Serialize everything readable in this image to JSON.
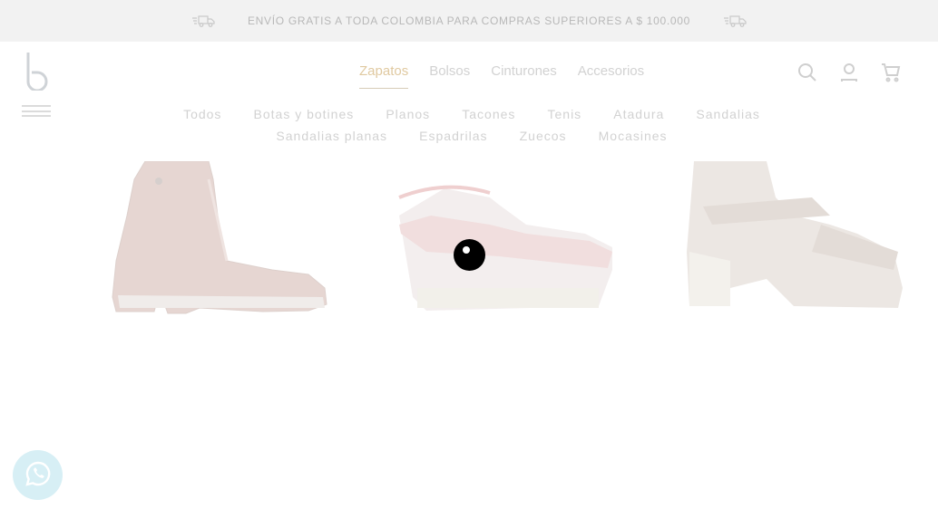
{
  "promo": {
    "message": "ENVÍO GRATIS A TODA COLOMBIA PARA COMPRAS SUPERIORES A $ 100.000",
    "left_icon": "truck-icon",
    "right_icon": "truck-icon"
  },
  "header": {
    "logo_icon": "brand-logo",
    "menu_icon": "hamburger-icon",
    "categories": [
      "Zapatos",
      "Bolsos",
      "Cinturones",
      "Accesorios"
    ],
    "active_category": "Zapatos",
    "icons": [
      "search-icon",
      "user-icon",
      "cart-icon"
    ]
  },
  "subnav": {
    "items": [
      "Todos",
      "Botas y botines",
      "Planos",
      "Tacones",
      "Tenis",
      "Atadura",
      "Sandalias",
      "Sandalias planas",
      "Espadrilas",
      "Zuecos",
      "Mocasines"
    ]
  },
  "products": [
    {
      "image": "lace-up-boot"
    },
    {
      "image": "espadrille-wedge"
    },
    {
      "image": "block-heel-sandal"
    }
  ],
  "floating": {
    "whatsapp_icon": "whatsapp-icon"
  },
  "colors": {
    "promo_bg": "#f2f2f2",
    "text_faded": "#d2d2d2",
    "active": "#e0c9a0"
  }
}
